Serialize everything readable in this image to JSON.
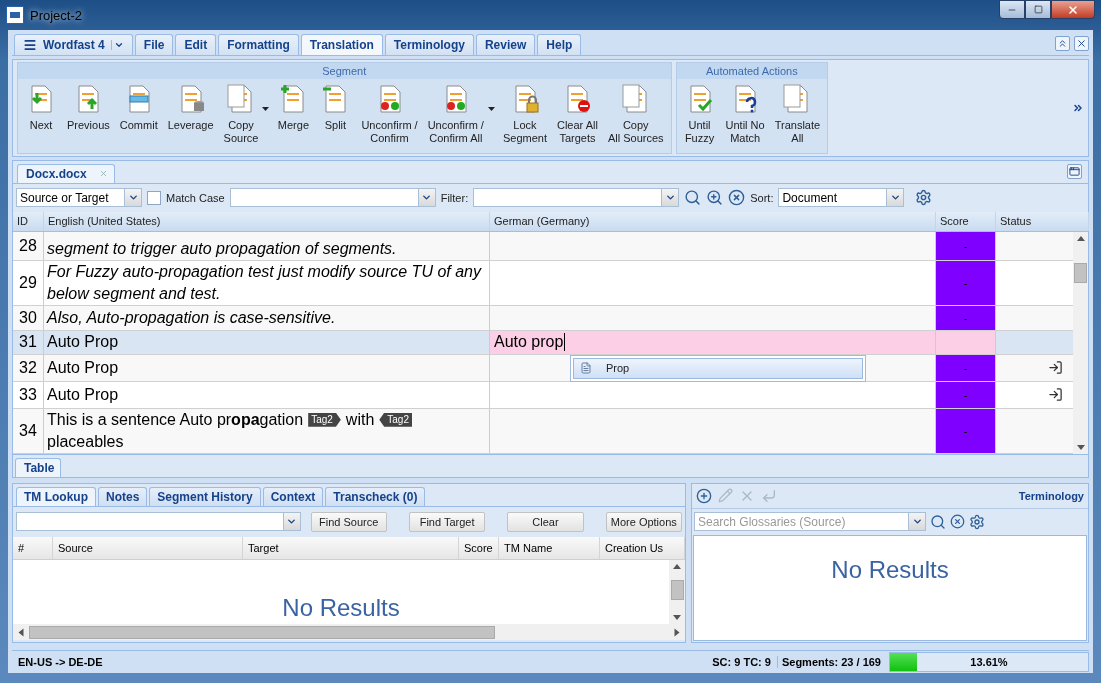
{
  "window": {
    "title": "Project-2"
  },
  "menu_tabs": [
    {
      "label": "Wordfast 4",
      "kind": "app",
      "selected": false
    },
    {
      "label": "File",
      "kind": "tab",
      "selected": false
    },
    {
      "label": "Edit",
      "kind": "tab",
      "selected": false
    },
    {
      "label": "Formatting",
      "kind": "tab",
      "selected": false
    },
    {
      "label": "Translation",
      "kind": "tab",
      "selected": true
    },
    {
      "label": "Terminology",
      "kind": "tab",
      "selected": false
    },
    {
      "label": "Review",
      "kind": "tab",
      "selected": false
    },
    {
      "label": "Help",
      "kind": "tab",
      "selected": false
    }
  ],
  "ribbon": {
    "groups": [
      {
        "title": "Segment",
        "buttons": [
          {
            "label": "Next",
            "kind": "next",
            "dropdown": false
          },
          {
            "label": "Previous",
            "kind": "previous",
            "dropdown": false
          },
          {
            "label": "Commit",
            "kind": "commit",
            "dropdown": false
          },
          {
            "label": "Leverage",
            "kind": "leverage",
            "dropdown": false
          },
          {
            "label": "Copy\nSource",
            "kind": "copy",
            "dropdown": true
          },
          {
            "label": "Merge",
            "kind": "merge",
            "dropdown": false
          },
          {
            "label": "Split",
            "kind": "split",
            "dropdown": false
          },
          {
            "label": "Unconfirm /\nConfirm",
            "kind": "confirm",
            "dropdown": false
          },
          {
            "label": "Unconfirm /\nConfirm All",
            "kind": "confirm_all",
            "dropdown": true
          },
          {
            "label": "Lock\nSegment",
            "kind": "lock",
            "dropdown": false
          },
          {
            "label": "Clear All\nTargets",
            "kind": "clear",
            "dropdown": false
          },
          {
            "label": "Copy\nAll Sources",
            "kind": "copy_all",
            "dropdown": false
          }
        ]
      },
      {
        "title": "Automated Actions",
        "buttons": [
          {
            "label": "Until\nFuzzy",
            "kind": "until_fuzzy",
            "dropdown": false
          },
          {
            "label": "Until No\nMatch",
            "kind": "until_no_match",
            "dropdown": false
          },
          {
            "label": "Translate\nAll",
            "kind": "translate_all",
            "dropdown": false
          }
        ]
      }
    ]
  },
  "document_tabs": [
    {
      "label": "Docx.docx",
      "selected": true
    }
  ],
  "filter_bar": {
    "scope": "Source or Target",
    "match_case": {
      "label": "Match Case",
      "checked": false
    },
    "filter_label": "Filter:",
    "sort_label": "Sort:",
    "sort": "Document"
  },
  "table": {
    "columns": [
      "ID",
      "English (United States)",
      "German (Germany)",
      "Score",
      "Status"
    ],
    "rows": [
      {
        "id": "28",
        "italic": true,
        "source": [
          {
            "kind": "text",
            "text": "segment to trigger auto propagation of segments."
          }
        ],
        "score": "-",
        "color": "#8000ff",
        "propagated": false,
        "selected": false
      },
      {
        "id": "29",
        "italic": true,
        "source": [
          {
            "kind": "text",
            "text": "For Fuzzy auto-propagation test just modify source TU of any below segment and test."
          }
        ],
        "score": "-",
        "color": "#8000ff",
        "propagated": false,
        "selected": false
      },
      {
        "id": "30",
        "italic": true,
        "source": [
          {
            "kind": "text",
            "text": "Also, Auto-propagation is case-sensitive."
          }
        ],
        "score": "-",
        "color": "#8000ff",
        "propagated": false,
        "selected": false
      },
      {
        "id": "31",
        "italic": false,
        "source": [
          {
            "kind": "text",
            "text": "Auto Prop"
          }
        ],
        "target": "Auto prop",
        "propagated": false,
        "selected": true
      },
      {
        "id": "32",
        "italic": false,
        "source": [
          {
            "kind": "text",
            "text": "Auto Prop"
          }
        ],
        "score": "-",
        "color": "#8000ff",
        "propagated": true,
        "selected": false
      },
      {
        "id": "33",
        "italic": false,
        "source": [
          {
            "kind": "text",
            "text": "Auto Prop"
          }
        ],
        "score": "-",
        "color": "#8000ff",
        "propagated": true,
        "selected": false
      },
      {
        "id": "34",
        "italic": false,
        "source": [
          {
            "kind": "text",
            "text": "This is a sentence Auto pr**opa**gation"
          },
          {
            "kind": "tag_open",
            "text": "Tag2"
          },
          {
            "kind": "text",
            "text": "with"
          },
          {
            "kind": "tag_close",
            "text": "Tag2"
          },
          {
            "kind": "text",
            "text": "placeables"
          }
        ],
        "score": "-",
        "color": "#8000ff",
        "propagated": false,
        "selected": false
      }
    ]
  },
  "autocomplete": {
    "items": [
      "Prop"
    ]
  },
  "view_tabs": [
    {
      "label": "Table",
      "selected": true
    }
  ],
  "tm_panel": {
    "tabs": [
      {
        "label": "TM Lookup",
        "selected": true
      },
      {
        "label": "Notes",
        "selected": false
      },
      {
        "label": "Segment History",
        "selected": false
      },
      {
        "label": "Context",
        "selected": false
      },
      {
        "label": "Transcheck (0)",
        "selected": false
      }
    ],
    "buttons": [
      "Find Source",
      "Find Target",
      "Clear",
      "More Options"
    ],
    "columns": [
      "#",
      "Source",
      "Target",
      "Score",
      "TM Name",
      "Creation Us"
    ],
    "empty": "No Results"
  },
  "terminology": {
    "title": "Terminology",
    "tools": [
      {
        "kind": "add",
        "disabled": false
      },
      {
        "kind": "edit",
        "disabled": true
      },
      {
        "kind": "delete",
        "disabled": true
      },
      {
        "kind": "insert",
        "disabled": true
      }
    ],
    "placeholder": "Search Glossaries (Source)",
    "empty": "No Results"
  },
  "status_bar": {
    "languages": "EN-US -> DE-DE",
    "counts": "SC: 9 TC: 9",
    "segments": "Segments: 23 / 169",
    "progress": {
      "level": 0.1361,
      "reading": "13.61%"
    }
  }
}
